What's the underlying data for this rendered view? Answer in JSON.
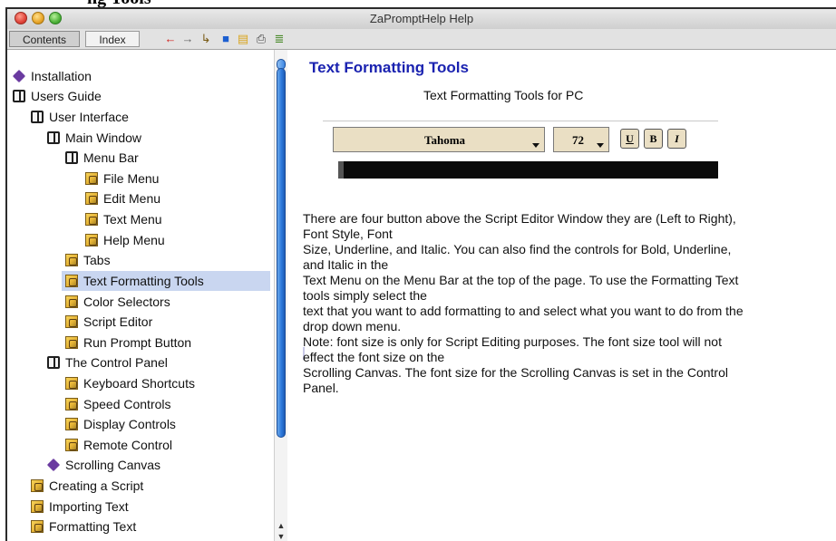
{
  "fragment": "ng Tools",
  "window": {
    "title": "ZaPromptHelp Help"
  },
  "tabs": [
    {
      "label": "Contents"
    },
    {
      "label": "Index"
    }
  ],
  "toolbar": {
    "icons": [
      "back-arrow-icon",
      "forward-arrow-icon",
      "sync-icon",
      "bookmark-icon",
      "folder-open-icon",
      "print-icon",
      "options-icon"
    ]
  },
  "tree": [
    {
      "label": "Installation",
      "icon": "diamond-icon"
    },
    {
      "label": "Users Guide",
      "icon": "open-book-icon"
    },
    {
      "label": "User Interface",
      "icon": "open-book-icon"
    },
    {
      "label": "Main Window",
      "icon": "open-book-icon"
    },
    {
      "label": "Menu Bar",
      "icon": "open-book-icon"
    },
    {
      "label": "File Menu",
      "icon": "page-icon"
    },
    {
      "label": "Edit Menu",
      "icon": "page-icon"
    },
    {
      "label": "Text Menu",
      "icon": "page-icon"
    },
    {
      "label": "Help Menu",
      "icon": "page-icon"
    },
    {
      "label": "Tabs",
      "icon": "page-icon"
    },
    {
      "label": "Text Formatting Tools",
      "icon": "page-icon",
      "selected": true
    },
    {
      "label": "Color Selectors",
      "icon": "page-icon"
    },
    {
      "label": "Script Editor",
      "icon": "page-icon"
    },
    {
      "label": "Run Prompt Button",
      "icon": "page-icon"
    },
    {
      "label": "The Control Panel",
      "icon": "open-book-icon"
    },
    {
      "label": "Keyboard Shortcuts",
      "icon": "page-icon"
    },
    {
      "label": "Speed Controls",
      "icon": "page-icon"
    },
    {
      "label": "Display Controls",
      "icon": "page-icon"
    },
    {
      "label": "Remote Control",
      "icon": "page-icon"
    },
    {
      "label": "Scrolling Canvas",
      "icon": "diamond-icon"
    },
    {
      "label": "Creating a Script",
      "icon": "page-icon"
    },
    {
      "label": "Importing Text",
      "icon": "page-icon"
    },
    {
      "label": "Formatting Text",
      "icon": "page-icon"
    }
  ],
  "content": {
    "title": "Text Formatting Tools",
    "subtitle": "Text Formatting Tools for PC",
    "font_select": "Tahoma",
    "size_select": "72",
    "buttons": [
      "U",
      "B",
      "I"
    ],
    "paragraph_lines": [
      "There are four button above the Script Editor Window they are (Left to Right),",
      "Font Style, Font",
      "Size, Underline, and Italic. You can also find the controls for Bold, Underline,",
      "and Italic in the",
      "Text Menu on the Menu Bar at the top of the page.  To use the Formatting Text",
      "tools simply select the",
      "text that you want to add formatting to and select what you want to do from the",
      "drop down menu.",
      "Note: font size is only for Script Editing purposes.  The font size tool will not",
      "effect the font size on the",
      "Scrolling Canvas.  The font size for the Scrolling Canvas is set in the Control",
      "Panel."
    ]
  },
  "colors": {
    "title_blue": "#1a22b0",
    "selection": "#c9d6f0",
    "scroll_thumb": "#2c79db",
    "button_beige": "#eadfc4"
  }
}
